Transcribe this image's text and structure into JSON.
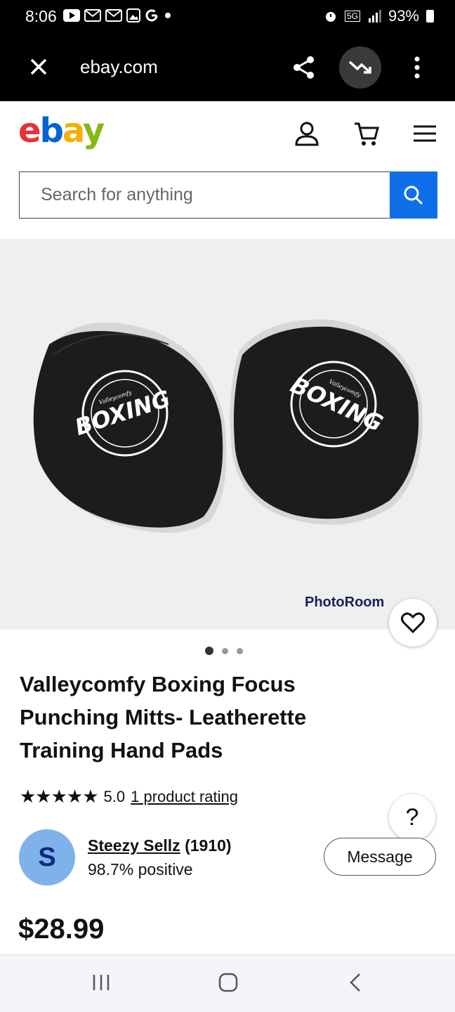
{
  "status_bar": {
    "time": "8:06",
    "left_icons": [
      "youtube-icon",
      "gmail-icon",
      "gmail-icon",
      "gallery-icon",
      "google-icon",
      "dot-icon"
    ],
    "network": "5G",
    "battery": "93%"
  },
  "browser": {
    "url": "ebay.com"
  },
  "header": {
    "logo": {
      "e": "e",
      "b": "b",
      "a": "a",
      "y": "y"
    },
    "search_placeholder": "Search for anything"
  },
  "image": {
    "watermark": "PhotoRoom",
    "pad_text": "BOXING",
    "pad_brand": "Valleycomfy",
    "carousel_total": 3,
    "carousel_active": 1
  },
  "product": {
    "title": "Valleycomfy Boxing Focus Punching Mitts- Leatherette Training Hand Pads",
    "stars": "★★★★★",
    "rating": "5.0",
    "rating_link": "1 product rating",
    "price": "$28.99"
  },
  "seller": {
    "initial": "S",
    "name": "Steezy Sellz",
    "feedback": "(1910)",
    "positive": "98.7% positive",
    "message_label": "Message"
  },
  "help_label": "?",
  "colors": {
    "accent": "#0f6fe8",
    "avatar": "#7fb1ea"
  }
}
